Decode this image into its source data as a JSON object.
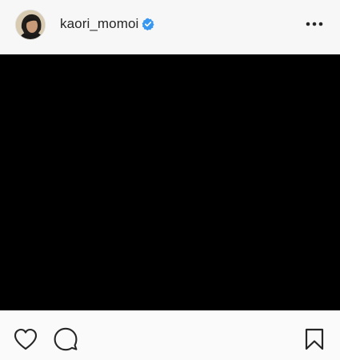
{
  "post": {
    "header": {
      "username": "kaori_momoi",
      "verified": true,
      "avatar_icon": "profile-photo"
    },
    "media": {
      "background": "#000000"
    },
    "actions": {
      "icons": [
        "heart-icon",
        "comment-icon",
        "bookmark-icon"
      ]
    }
  },
  "colors": {
    "verified_badge": "#3897f0",
    "text": "#262626",
    "icon": "#262626"
  }
}
